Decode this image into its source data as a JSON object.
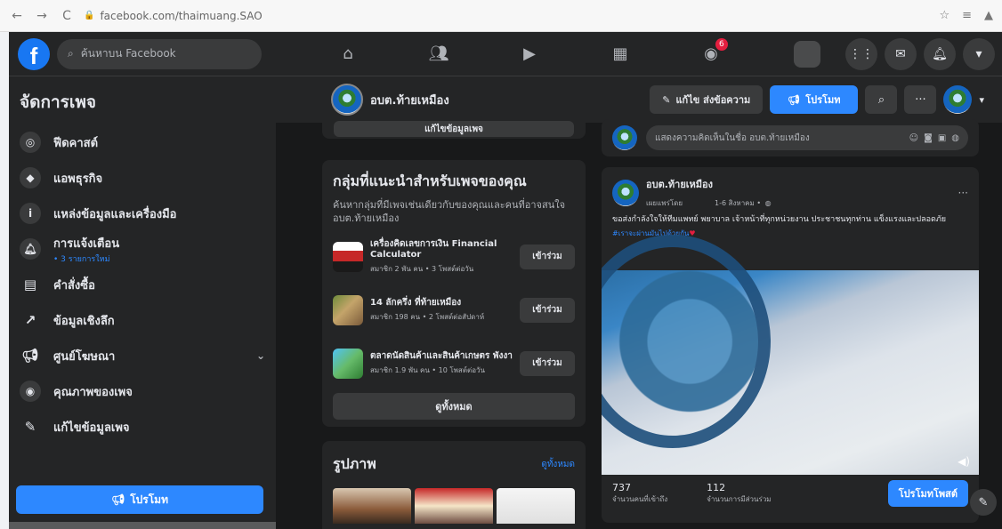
{
  "browser": {
    "url": "facebook.com/thaimuang.SAO",
    "back_icon": "arrow-left",
    "forward_icon": "arrow-right",
    "reload_icon": "reload",
    "star_icon": "star",
    "reading_list_icon": "list",
    "profile_icon": "person"
  },
  "topbar": {
    "search_placeholder": "ค้นหาบน Facebook",
    "notification_badge": "6",
    "menu_icon": "grid",
    "messenger_icon": "messenger",
    "bell_icon": "bell",
    "caret_icon": "chevron-down"
  },
  "sidebar": {
    "title": "จัดการเพจ",
    "items": [
      {
        "label": "ฟีดคาสต์",
        "sub": "",
        "icon": "broadcast-icon"
      },
      {
        "label": "แอพธุรกิจ",
        "sub": "",
        "icon": "cube-icon"
      },
      {
        "label": "แหล่งข้อมูลและเครื่องมือ",
        "sub": "",
        "icon": "info-icon"
      },
      {
        "label": "การแจ้งเตือน",
        "sub": "• 3 รายการใหม่",
        "icon": "bell-icon"
      },
      {
        "label": "คำสั่งซื้อ",
        "sub": "",
        "icon": "list-icon"
      },
      {
        "label": "ข้อมูลเชิงลึก",
        "sub": "",
        "icon": "trend-icon"
      },
      {
        "label": "ศูนย์โฆษณา",
        "sub": "",
        "icon": "megaphone-icon"
      },
      {
        "label": "คุณภาพของเพจ",
        "sub": "",
        "icon": "shield-icon"
      },
      {
        "label": "แก้ไขข้อมูลเพจ",
        "sub": "",
        "icon": "pencil-icon"
      }
    ],
    "promote_label": "โปรโมท"
  },
  "page": {
    "name": "อบต.ท้ายเหมือง",
    "edit_send_label": "แก้ไข ส่งข้อความ",
    "promote_label": "โปรโมท",
    "edit_info_label": "แก้ไขข้อมูลเพจ"
  },
  "groups": {
    "title": "กลุ่มที่แนะนำสำหรับเพจของคุณ",
    "description": "ค้นหากลุ่มที่มีเพจเช่นเดียวกับของคุณและคนที่อาจสนใจ อบต.ท้ายเหมือง",
    "items": [
      {
        "name": "เครื่องคิดเลขการเงิน Financial Calculator",
        "meta": "สมาชิก 2 พัน คน • 3 โพสต์ต่อวัน",
        "join": "เข้าร่วม"
      },
      {
        "name": "14 ลักครึ่ง ที่ท้ายเหมือง",
        "meta": "สมาชิก 198 คน • 2 โพสต์ต่อสัปดาห์",
        "join": "เข้าร่วม"
      },
      {
        "name": "ตลาดนัดสินค้าและสินค้าเกษตร พังงา",
        "meta": "สมาชิก 1.9 พัน คน • 10 โพสต์ต่อวัน",
        "join": "เข้าร่วม"
      }
    ],
    "see_all": "ดูทั้งหมด"
  },
  "photos": {
    "title": "รูปภาพ",
    "see_all": "ดูทั้งหมด"
  },
  "composer": {
    "placeholder": "แสดงความคิดเห็นในชื่อ อบต.ท้ายเหมือง"
  },
  "post": {
    "author": "อบต.ท้ายเหมือง",
    "by": "เผยแพร่โดย",
    "date": "1-6 สิงหาคม • ",
    "text": "ขอส่งกำลังใจให้ทีมแพทย์ พยาบาล เจ้าหน้าที่ทุกหน่วยงาน ประชาชนทุกท่าน แข็งแรงและปลอดภัย",
    "tag": "#เราจะผ่านมันไปด้วยกัน",
    "reach": "737",
    "reach_label": "จำนวนคนที่เข้าถึง",
    "engagement": "112",
    "engagement_label": "จำนวนการมีส่วนร่วม",
    "boost_label": "โปรโมทโพสต์"
  },
  "colors": {
    "accent": "#2d88ff",
    "surface": "#242526",
    "background": "#18191a",
    "badge": "#e41e3f"
  }
}
